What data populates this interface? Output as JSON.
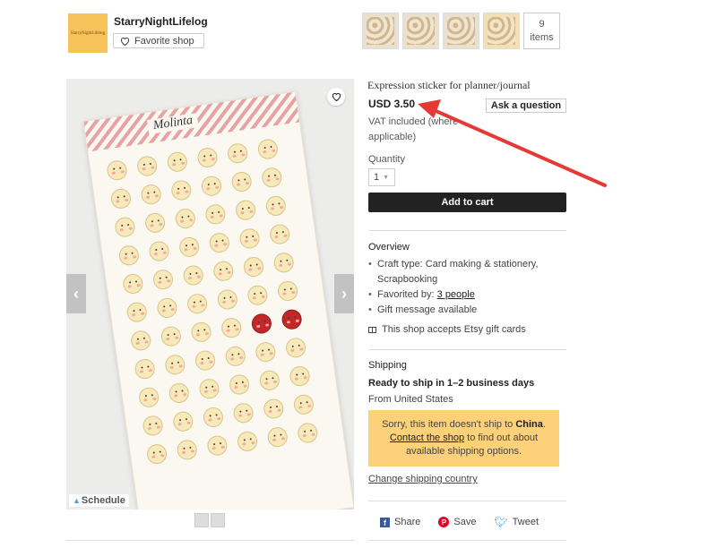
{
  "shop": {
    "logo_text": "StarryNightLifelog",
    "name": "StarryNightLifelog",
    "favorite_label": "Favorite shop"
  },
  "gallery": {
    "more_count": "9",
    "more_label": "items"
  },
  "image": {
    "brand": "Molinta",
    "schedule_label": "Schedule"
  },
  "listing": {
    "title": "Expression sticker for planner/journal",
    "price": "USD 3.50",
    "ask_label": "Ask a question",
    "vat_line1": "VAT included (where",
    "vat_line2": "applicable)",
    "quantity_label": "Quantity",
    "quantity_value": "1",
    "add_to_cart": "Add to cart"
  },
  "overview": {
    "title": "Overview",
    "craft_line1": "Craft type: Card making & stationery,",
    "craft_line2": "Scrapbooking",
    "favorited_prefix": "Favorited by: ",
    "favorited_link": "3 people",
    "gift_message": "Gift message available",
    "gift_cards": "This shop accepts Etsy gift cards"
  },
  "shipping": {
    "title": "Shipping",
    "ready": "Ready to ship in 1–2 business days",
    "from": "From United States",
    "warn_text1": "Sorry, this item doesn't ship to",
    "warn_country": "China",
    "warn_link": "Contact the shop",
    "warn_text2": "to find out about available shipping options.",
    "change_country": "Change shipping country"
  },
  "share": {
    "facebook": "Share",
    "pinterest": "Save",
    "twitter": "Tweet"
  },
  "colors": {
    "annotation_arrow": "#e53935",
    "warning_bg": "#fdd07a",
    "cart_button": "#222222"
  }
}
